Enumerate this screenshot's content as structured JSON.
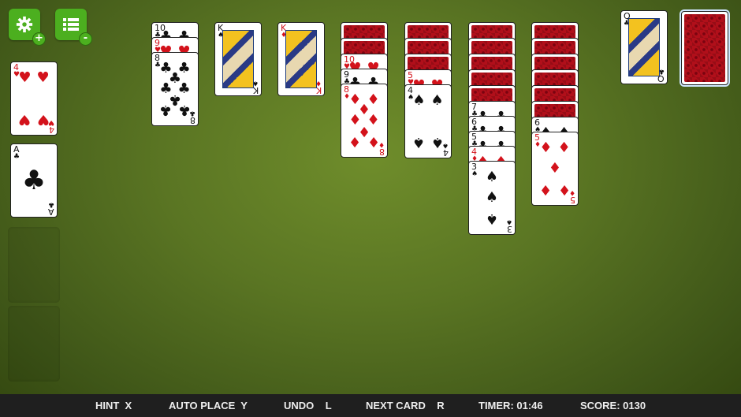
{
  "toolbar": {
    "settings_badge": "+",
    "menu_badge": "-"
  },
  "foundations": [
    {
      "rank": "4",
      "suit": "♥",
      "color": "red"
    },
    {
      "rank": "A",
      "suit": "♣",
      "color": "blk"
    }
  ],
  "tableau": [
    {
      "facedown": 0,
      "cards": [
        {
          "rank": "10",
          "suit": "♣",
          "color": "blk"
        },
        {
          "rank": "9",
          "suit": "♥",
          "color": "red"
        },
        {
          "rank": "8",
          "suit": "♣",
          "color": "blk"
        }
      ]
    },
    {
      "facedown": 0,
      "cards": [
        {
          "rank": "K",
          "suit": "♠",
          "color": "blk"
        }
      ]
    },
    {
      "facedown": 0,
      "cards": [
        {
          "rank": "K",
          "suit": "♦",
          "color": "red"
        }
      ]
    },
    {
      "facedown": 2,
      "cards": [
        {
          "rank": "10",
          "suit": "♥",
          "color": "red"
        },
        {
          "rank": "9",
          "suit": "♣",
          "color": "blk"
        },
        {
          "rank": "8",
          "suit": "♦",
          "color": "red"
        }
      ]
    },
    {
      "facedown": 3,
      "cards": [
        {
          "rank": "5",
          "suit": "♥",
          "color": "red"
        },
        {
          "rank": "4",
          "suit": "♠",
          "color": "blk"
        }
      ]
    },
    {
      "facedown": 5,
      "cards": [
        {
          "rank": "7",
          "suit": "♣",
          "color": "blk"
        },
        {
          "rank": "6",
          "suit": "♣",
          "color": "blk"
        },
        {
          "rank": "5",
          "suit": "♣",
          "color": "blk"
        },
        {
          "rank": "4",
          "suit": "♦",
          "color": "red"
        },
        {
          "rank": "3",
          "suit": "♠",
          "color": "blk"
        }
      ]
    },
    {
      "facedown": 6,
      "cards": [
        {
          "rank": "6",
          "suit": "♠",
          "color": "blk"
        },
        {
          "rank": "5",
          "suit": "♦",
          "color": "red"
        }
      ]
    }
  ],
  "waste": {
    "rank": "Q",
    "suit": "♣",
    "color": "blk"
  },
  "status_bar": {
    "hint": "HINT  X",
    "auto_place": "AUTO PLACE  Y",
    "undo": "UNDO    L",
    "next_card": "NEXT CARD    R",
    "timer": "TIMER: 01:46",
    "score": "SCORE: 0130"
  }
}
